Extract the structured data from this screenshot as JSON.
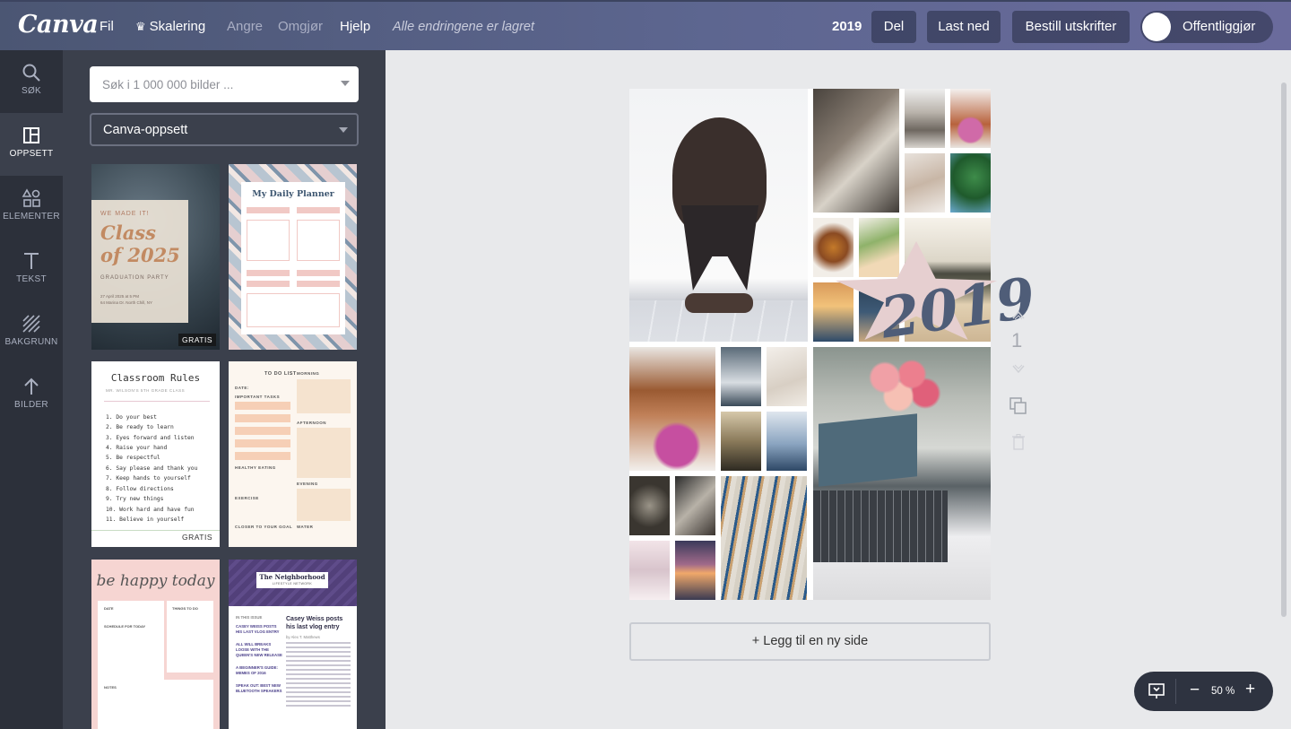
{
  "app": {
    "logo": "Canva"
  },
  "menu": {
    "file": "Fil",
    "resize": "Skalering",
    "undo": "Angre",
    "redo": "Omgjør",
    "help": "Hjelp",
    "status": "Alle endringene er lagret"
  },
  "toolbar": {
    "doc_name": "2019",
    "share": "Del",
    "download": "Last ned",
    "order_prints": "Bestill utskrifter",
    "publish": "Offentliggjør"
  },
  "rail": [
    {
      "label": "SØK",
      "icon": "search-icon"
    },
    {
      "label": "OPPSETT",
      "icon": "layout-icon"
    },
    {
      "label": "ELEMENTER",
      "icon": "elements-icon"
    },
    {
      "label": "TEKST",
      "icon": "text-icon"
    },
    {
      "label": "BAKGRUNN",
      "icon": "background-icon"
    },
    {
      "label": "BILDER",
      "icon": "upload-icon"
    }
  ],
  "panel": {
    "search_placeholder": "Søk i 1 000 000 bilder ...",
    "layout_select": "Canva-oppsett",
    "templates": [
      {
        "lines": [
          "WE MADE IT!",
          "Class",
          "of 2025",
          "GRADUATION PARTY",
          "27 April 2025 at 5 PM",
          "64 Marina Dr. North Chill, NY"
        ],
        "badge": "GRATIS"
      },
      {
        "lines": [
          "My Daily Planner",
          "DATE",
          "DAY",
          "TO DO",
          "DON'T FORGET",
          "IMPORTANT",
          "TASK NOTE"
        ]
      },
      {
        "title": "Classroom Rules",
        "subtitle": "MR. WILSON'S 5TH GRADE CLASS",
        "items": [
          "1. Do your best",
          "2. Be ready to learn",
          "3. Eyes forward and listen",
          "4. Raise your hand",
          "5. Be respectful",
          "6. Say please and thank you",
          "7. Keep hands to yourself",
          "8. Follow directions",
          "9. Try new things",
          "10. Work hard and have fun",
          "11. Believe in yourself"
        ],
        "badge": "GRATIS"
      },
      {
        "lines": [
          "TO DO LIST",
          "DATE:",
          "IMPORTANT TASKS",
          "MORNING",
          "AFTERNOON",
          "HEALTHY EATING",
          "EXERCISE",
          "EVENING",
          "CLOSER TO YOUR GOAL",
          "WATER"
        ]
      },
      {
        "title": "be happy today",
        "lines": [
          "DATE",
          "THINGS TO DO",
          "SCHEDULE FOR TODAY",
          "NOTES"
        ]
      },
      {
        "title": "The Neighborhood",
        "subtitle": "LIFESTYLE NETWORK",
        "headline": "Casey Weiss posts his last vlog entry",
        "byline": "by Alex T. Matthews",
        "side": [
          "IN THIS ISSUE",
          "CASEY WEISS POSTS HIS LAST VLOG ENTRY",
          "ALL WILL BREAKS LOOSE WITH THE QUEEN'S NEW RELEASE",
          "A BEGINNER'S GUIDE: MEMES OF 2016",
          "SPEAK OUT: BEST NEW BLUETOOTH SPEAKERS"
        ]
      }
    ]
  },
  "canvas": {
    "page_number": "1",
    "year_text": "2019",
    "add_page": "+ Legg til en ny side"
  },
  "zoom": {
    "level": "50 %",
    "minus": "−",
    "plus": "+"
  },
  "colors": {
    "topbar_start": "#4b5673",
    "topbar_end": "#6a6b9c",
    "rail": "#2c303a",
    "panel": "#3b404c",
    "canvas_bg": "#e8e9eb"
  }
}
